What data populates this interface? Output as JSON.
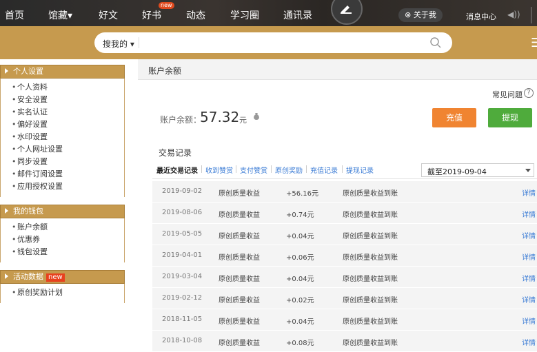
{
  "nav": {
    "items": [
      "首页",
      "馆藏▾",
      "好文",
      "好书",
      "动态",
      "学习圈",
      "通讯录"
    ],
    "new_badge": "new",
    "about": "关于我",
    "messages": "消息中心"
  },
  "search": {
    "scope": "搜我的",
    "placeholder": ""
  },
  "sidebar": {
    "sections": [
      {
        "title": "个人设置",
        "items": [
          "个人资料",
          "安全设置",
          "实名认证",
          "偏好设置",
          "水印设置",
          "个人网址设置",
          "同步设置",
          "邮件订阅设置",
          "应用授权设置"
        ]
      },
      {
        "title": "我的钱包",
        "items": [
          "账户余额",
          "优惠券",
          "钱包设置"
        ]
      },
      {
        "title": "活动数据",
        "badge": "new",
        "items": [
          "原创奖励计划"
        ]
      }
    ]
  },
  "main": {
    "title": "账户余额",
    "faq": "常见问题",
    "balance_label": "账户余额：",
    "balance_value": "57.32",
    "balance_unit": "元",
    "charge_button": "充值",
    "withdraw_button": "提现",
    "records_title": "交易记录",
    "tabs": [
      "最近交易记录",
      "收到赞赏",
      "支付赞赏",
      "原创奖励",
      "充值记录",
      "提现记录"
    ],
    "date_filter": "截至2019-09-04",
    "rows": [
      {
        "date": "2019-09-02",
        "type": "原创质量收益",
        "amount": "+56.16元",
        "note": "原创质量收益到账",
        "link": "详情"
      },
      {
        "date": "2019-08-06",
        "type": "原创质量收益",
        "amount": "+0.74元",
        "note": "原创质量收益到账",
        "link": "详情"
      },
      {
        "date": "2019-05-05",
        "type": "原创质量收益",
        "amount": "+0.04元",
        "note": "原创质量收益到账",
        "link": "详情"
      },
      {
        "date": "2019-04-01",
        "type": "原创质量收益",
        "amount": "+0.06元",
        "note": "原创质量收益到账",
        "link": "详情"
      },
      {
        "date": "2019-03-04",
        "type": "原创质量收益",
        "amount": "+0.04元",
        "note": "原创质量收益到账",
        "link": "详情"
      },
      {
        "date": "2019-02-12",
        "type": "原创质量收益",
        "amount": "+0.02元",
        "note": "原创质量收益到账",
        "link": "详情"
      },
      {
        "date": "2018-11-05",
        "type": "原创质量收益",
        "amount": "+0.04元",
        "note": "原创质量收益到账",
        "link": "详情"
      },
      {
        "date": "2018-10-08",
        "type": "原创质量收益",
        "amount": "+0.08元",
        "note": "原创质量收益到账",
        "link": "详情"
      }
    ]
  },
  "colors": {
    "brand_gold": "#c69a4e",
    "charge_orange": "#f08431",
    "withdraw_green": "#4fab3c",
    "link_blue": "#3a7bd5"
  }
}
